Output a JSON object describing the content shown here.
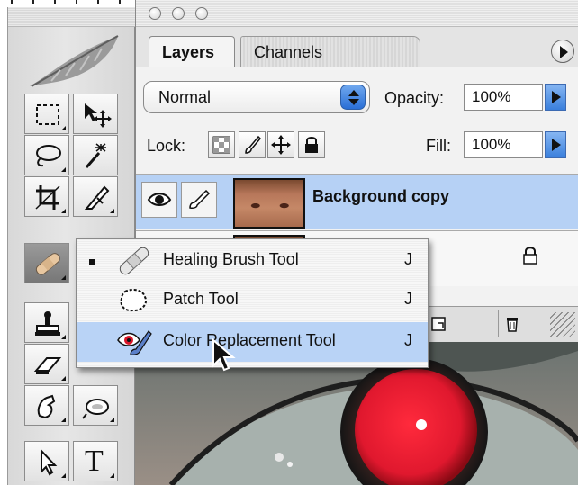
{
  "panel": {
    "tabs": [
      {
        "label": "Layers",
        "active": true
      },
      {
        "label": "Channels",
        "active": false
      }
    ],
    "blend_mode": "Normal",
    "opacity_label": "Opacity:",
    "opacity_value": "100%",
    "lock_label": "Lock:",
    "fill_label": "Fill:",
    "fill_value": "100%",
    "layers": [
      {
        "name": "Background copy",
        "selected": true,
        "visible": true
      },
      {
        "name": "",
        "selected": false,
        "locked": true
      }
    ]
  },
  "tool_flyout": {
    "items": [
      {
        "label": "Healing Brush Tool",
        "shortcut": "J",
        "icon": "bandage-icon",
        "checked": true
      },
      {
        "label": "Patch Tool",
        "shortcut": "J",
        "icon": "patch-icon",
        "checked": false
      },
      {
        "label": "Color Replacement Tool",
        "shortcut": "J",
        "icon": "color-replacement-icon",
        "checked": false,
        "highlighted": true
      }
    ]
  },
  "toolbox": {
    "tools": [
      "marquee-icon",
      "move-icon",
      "lasso-icon",
      "magic-wand-icon",
      "crop-icon",
      "slice-icon",
      "healing-brush-icon",
      "stamp-icon",
      "eraser-icon",
      "smudge-icon",
      "dodge-icon",
      "path-select-icon",
      "type-icon"
    ],
    "type_glyph": "T"
  },
  "colors": {
    "selection": "#b6d1f5",
    "aqua_blue": "#3a7fdc",
    "redeye": "#e0182e"
  }
}
